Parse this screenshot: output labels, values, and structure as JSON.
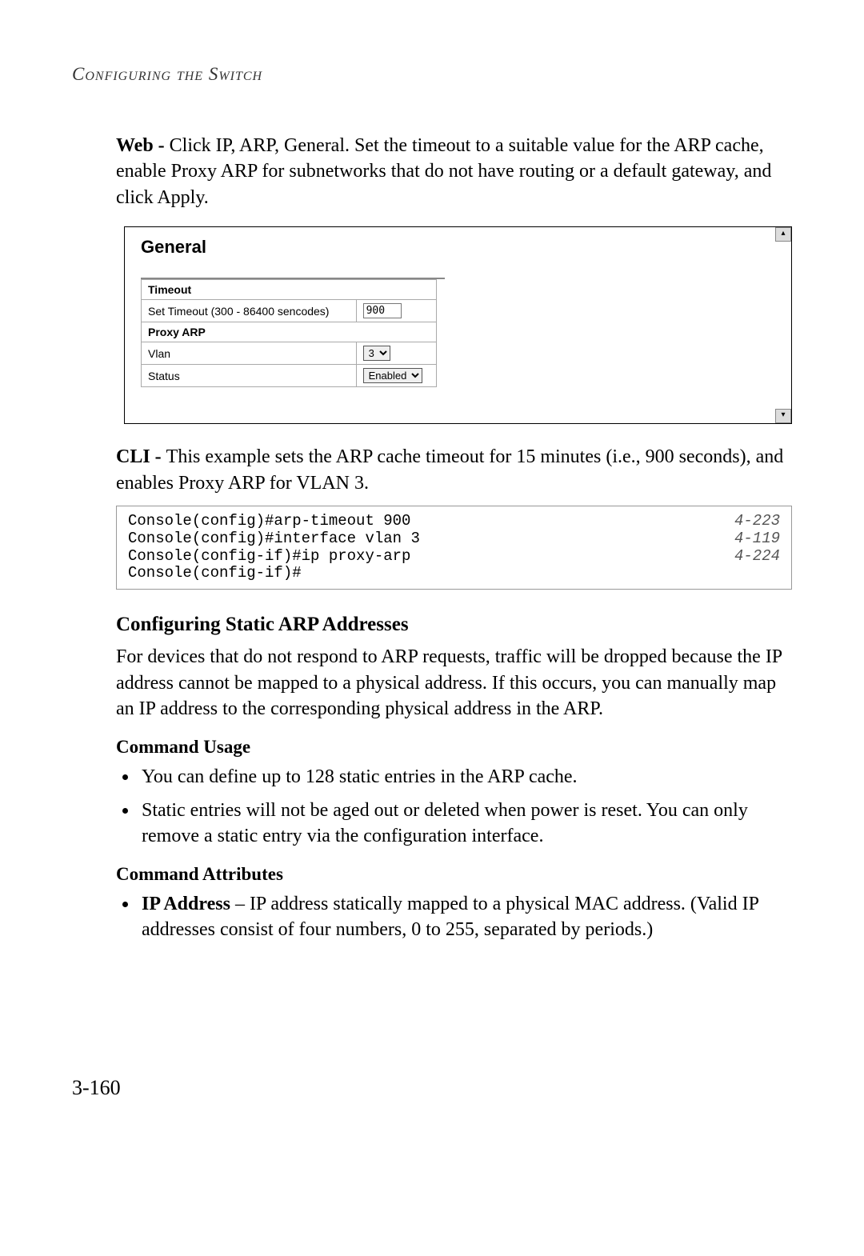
{
  "header": "Configuring the Switch",
  "para1": {
    "label": "Web - ",
    "text": "Click IP, ARP, General. Set the timeout to a suitable value for the ARP cache, enable Proxy ARP for subnetworks that do not have routing or a default gateway, and click Apply."
  },
  "screenshot": {
    "title": "General",
    "timeout_header": "Timeout",
    "timeout_label": "Set Timeout (300 - 86400 sencodes)",
    "timeout_value": "900",
    "proxy_header": "Proxy ARP",
    "vlan_label": "Vlan",
    "vlan_value": "3",
    "status_label": "Status",
    "status_value": "Enabled",
    "scroll_up": "▴",
    "scroll_down": "▾"
  },
  "para2": {
    "label": "CLI - ",
    "text": "This example sets the ARP cache timeout for 15 minutes (i.e., 900 seconds), and enables Proxy ARP for VLAN 3."
  },
  "cli": {
    "lines": [
      {
        "cmd": "Console(config)#arp-timeout 900",
        "ref": "4-223"
      },
      {
        "cmd": "Console(config)#interface vlan 3",
        "ref": "4-119"
      },
      {
        "cmd": "Console(config-if)#ip proxy-arp",
        "ref": "4-224"
      },
      {
        "cmd": "Console(config-if)#",
        "ref": ""
      }
    ]
  },
  "section2_title": "Configuring Static ARP Addresses",
  "section2_text": "For devices that do not respond to ARP requests, traffic will be dropped because the IP address cannot be mapped to a physical address. If this occurs, you can manually map an IP address to the corresponding physical address in the ARP.",
  "cmd_usage_title": "Command Usage",
  "usage_items": [
    "You can define up to 128 static entries in the ARP cache.",
    "Static entries will not be aged out or deleted when power is reset. You can only remove a static entry via the configuration interface."
  ],
  "cmd_attr_title": "Command Attributes",
  "attr_items": [
    {
      "name": "IP Address",
      "desc": " – IP address statically mapped to a physical MAC address. (Valid IP addresses consist of four numbers, 0 to 255, separated by periods.)"
    }
  ],
  "page_num": "3-160"
}
